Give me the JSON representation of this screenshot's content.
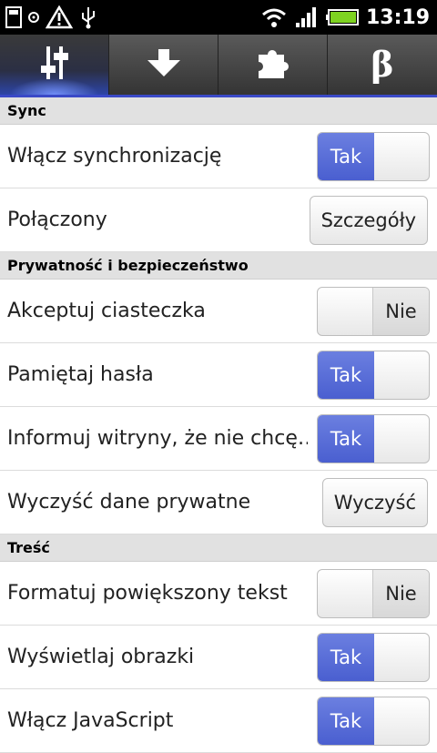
{
  "status_bar": {
    "time": "13:19",
    "icons": [
      "sd-card-icon",
      "settings-icon",
      "warning-icon",
      "usb-icon",
      "wifi-icon",
      "signal-icon",
      "battery-icon"
    ]
  },
  "tabs": [
    {
      "name": "settings-sliders-icon",
      "active": true
    },
    {
      "name": "download-arrow-icon",
      "active": false
    },
    {
      "name": "puzzle-piece-icon",
      "active": false
    },
    {
      "name": "beta",
      "label": "β",
      "active": false
    }
  ],
  "sections": [
    {
      "title": "Sync",
      "rows": [
        {
          "label": "Włącz synchronizację",
          "control": "toggle",
          "on_label": "Tak",
          "off_label": "",
          "state": "on"
        },
        {
          "label": "Połączony",
          "control": "button",
          "button_label": "Szczegóły"
        }
      ]
    },
    {
      "title": "Prywatność i bezpieczeństwo",
      "rows": [
        {
          "label": "Akceptuj ciasteczka",
          "control": "toggle",
          "on_label": "",
          "off_label": "Nie",
          "state": "off"
        },
        {
          "label": "Pamiętaj hasła",
          "control": "toggle",
          "on_label": "Tak",
          "off_label": "",
          "state": "on"
        },
        {
          "label": "Informuj witryny, że nie chcę…",
          "control": "toggle",
          "on_label": "Tak",
          "off_label": "",
          "state": "on"
        },
        {
          "label": "Wyczyść dane prywatne",
          "control": "button",
          "button_label": "Wyczyść"
        }
      ]
    },
    {
      "title": "Treść",
      "rows": [
        {
          "label": "Formatuj powiększony tekst",
          "control": "toggle",
          "on_label": "",
          "off_label": "Nie",
          "state": "off"
        },
        {
          "label": "Wyświetlaj obrazki",
          "control": "toggle",
          "on_label": "Tak",
          "off_label": "",
          "state": "on"
        },
        {
          "label": "Włącz JavaScript",
          "control": "toggle",
          "on_label": "Tak",
          "off_label": "",
          "state": "on"
        }
      ]
    }
  ],
  "colors": {
    "accent": "#4a5fd0",
    "section_bg": "#e1e1e1",
    "tabbar_bg": "#444444"
  }
}
